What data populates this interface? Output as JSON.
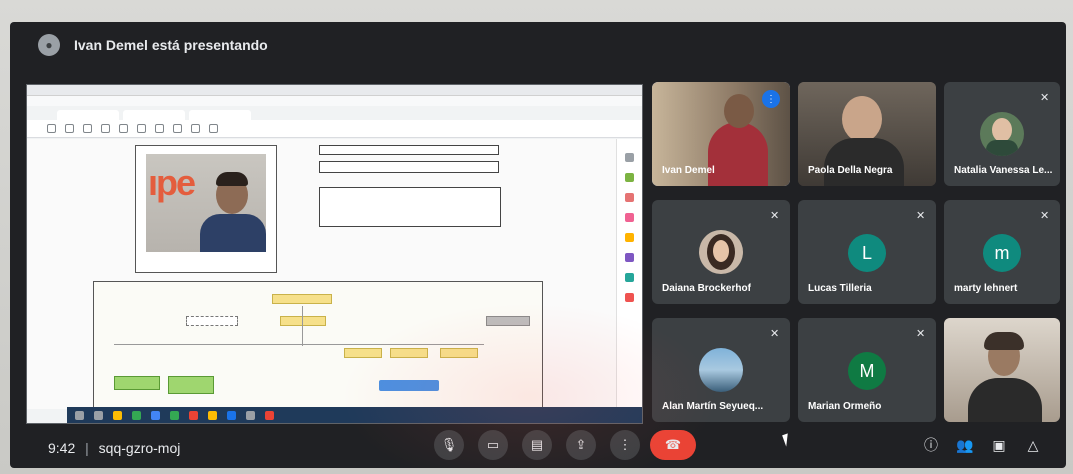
{
  "presenter": {
    "text": "Ivan Demel está presentando"
  },
  "meeting": {
    "time": "9:42",
    "separator": "|",
    "code": "sqq-gzro-moj"
  },
  "participants": [
    {
      "name": "Ivan Demel"
    },
    {
      "name": "Paola Della Negra"
    },
    {
      "name": "Natalia Vanessa Le..."
    },
    {
      "name": "Daiana Brockerhof"
    },
    {
      "name": "Lucas Tilleria",
      "initial": "L"
    },
    {
      "name": "marty lehnert",
      "initial": "m"
    },
    {
      "name": "Alan Martín Seyueq..."
    },
    {
      "name": "Marian Ormeño",
      "initial": "M"
    },
    {
      "name": ""
    }
  ],
  "colors": {
    "lucas_avatar": "#0f8a7e",
    "marty_avatar": "#0f8a7e",
    "marian_avatar": "#0f7a43",
    "end_call": "#ea4335",
    "active_speaker": "#8ab4f8"
  },
  "controls": {
    "mic": "mic-icon",
    "camera": "camera-icon",
    "captions": "captions-icon",
    "present": "present-icon",
    "more": "more-options-icon",
    "end": "end-call-icon",
    "info": "info-icon",
    "people": "people-icon",
    "chat": "chat-icon",
    "activities": "activities-icon"
  }
}
